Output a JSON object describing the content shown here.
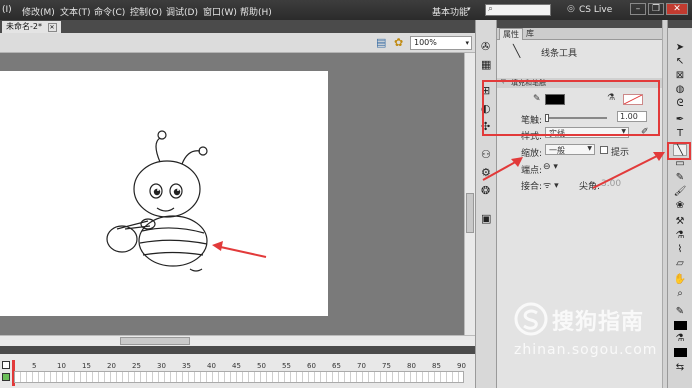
{
  "menubar": {
    "items": [
      "(I)",
      "修改(M)",
      "文本(T)",
      "命令(C)",
      "控制(O)",
      "调试(D)",
      "窗口(W)",
      "帮助(H)"
    ],
    "workspace_label": "基本功能",
    "cs_live_label": "CS Live"
  },
  "document": {
    "tab_label": "未命名-2*",
    "zoom_value": "100%"
  },
  "timeline": {
    "frame_numbers": [
      "5",
      "10",
      "15",
      "20",
      "25",
      "30",
      "35",
      "40",
      "45",
      "50",
      "55",
      "60",
      "65",
      "70",
      "75",
      "80",
      "85",
      "90"
    ]
  },
  "properties_panel": {
    "tabs": [
      "属性",
      "库"
    ],
    "tool_name": "线条工具",
    "section_fill_stroke": "填充和笔触",
    "stroke_label": "笔触:",
    "stroke_value": "1.00",
    "style_label": "样式:",
    "style_value": "实线",
    "scale_label": "缩放:",
    "scale_value": "一般",
    "hint_label": "提示",
    "cap_label": "端点:",
    "join_label": "接合:",
    "miter_label": "尖角:",
    "miter_value": "3.00"
  },
  "watermark": {
    "brand": "搜狗指南",
    "url": "zhinan.sogou.com"
  },
  "colors": {
    "annotation_red": "#e23a3a",
    "stroke_color": "#000000",
    "menubar_bg": "#333333"
  }
}
